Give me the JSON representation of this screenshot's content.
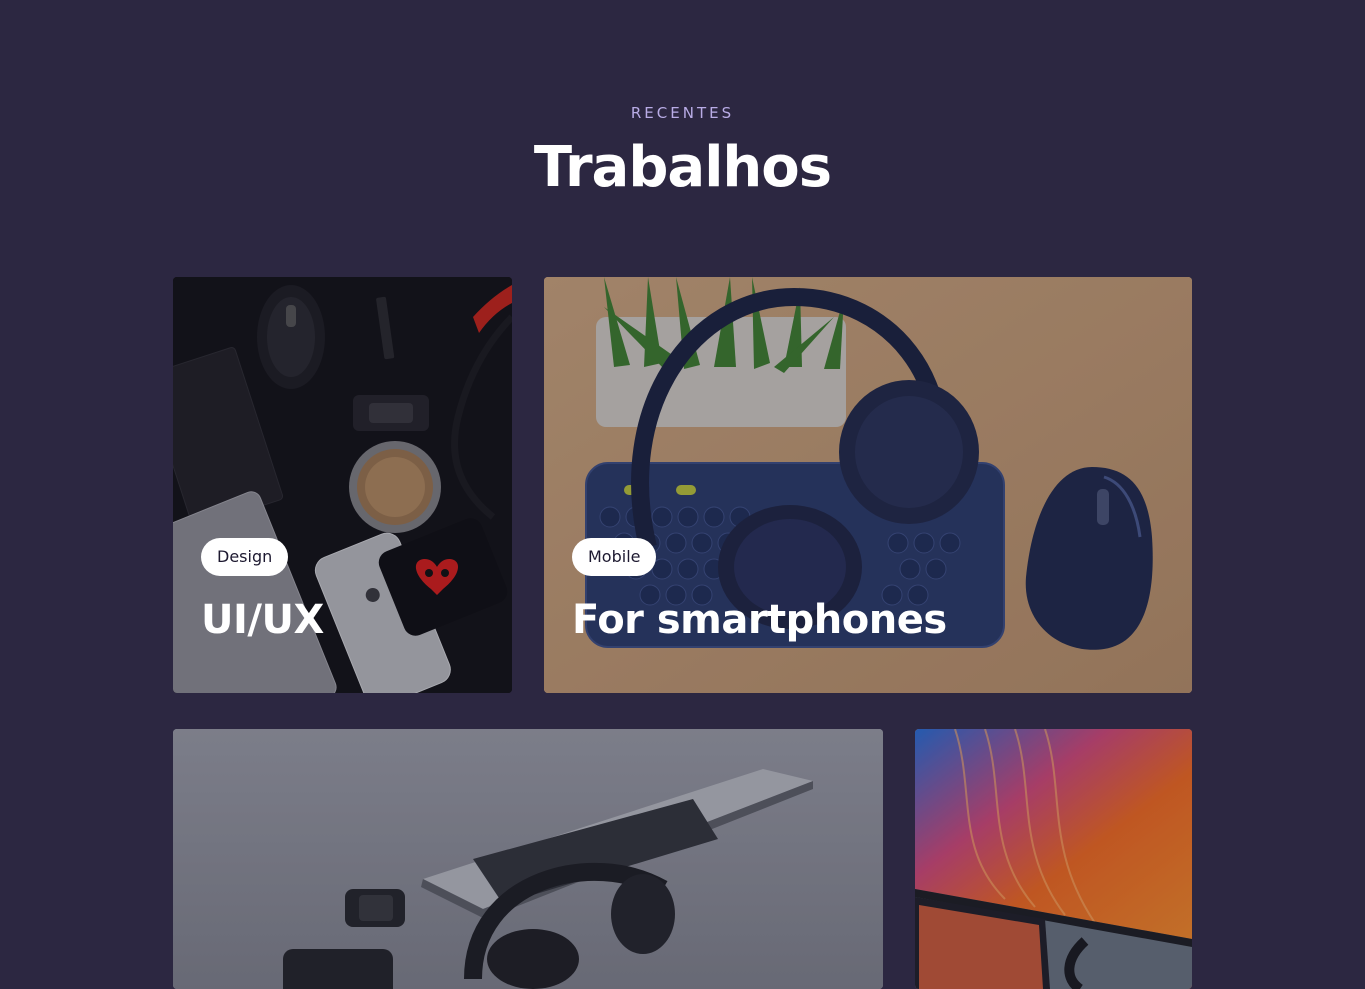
{
  "section": {
    "eyebrow": "RECENTES",
    "title": "Trabalhos"
  },
  "works": [
    {
      "tag": "Design",
      "title": "UI/UX"
    },
    {
      "tag": "Mobile",
      "title": "For smartphones"
    }
  ],
  "colors": {
    "background": "#2c2741",
    "eyebrow": "#b9ace6",
    "title": "#ffffff",
    "badge_bg": "#ffffff",
    "badge_text": "#1d1930"
  }
}
